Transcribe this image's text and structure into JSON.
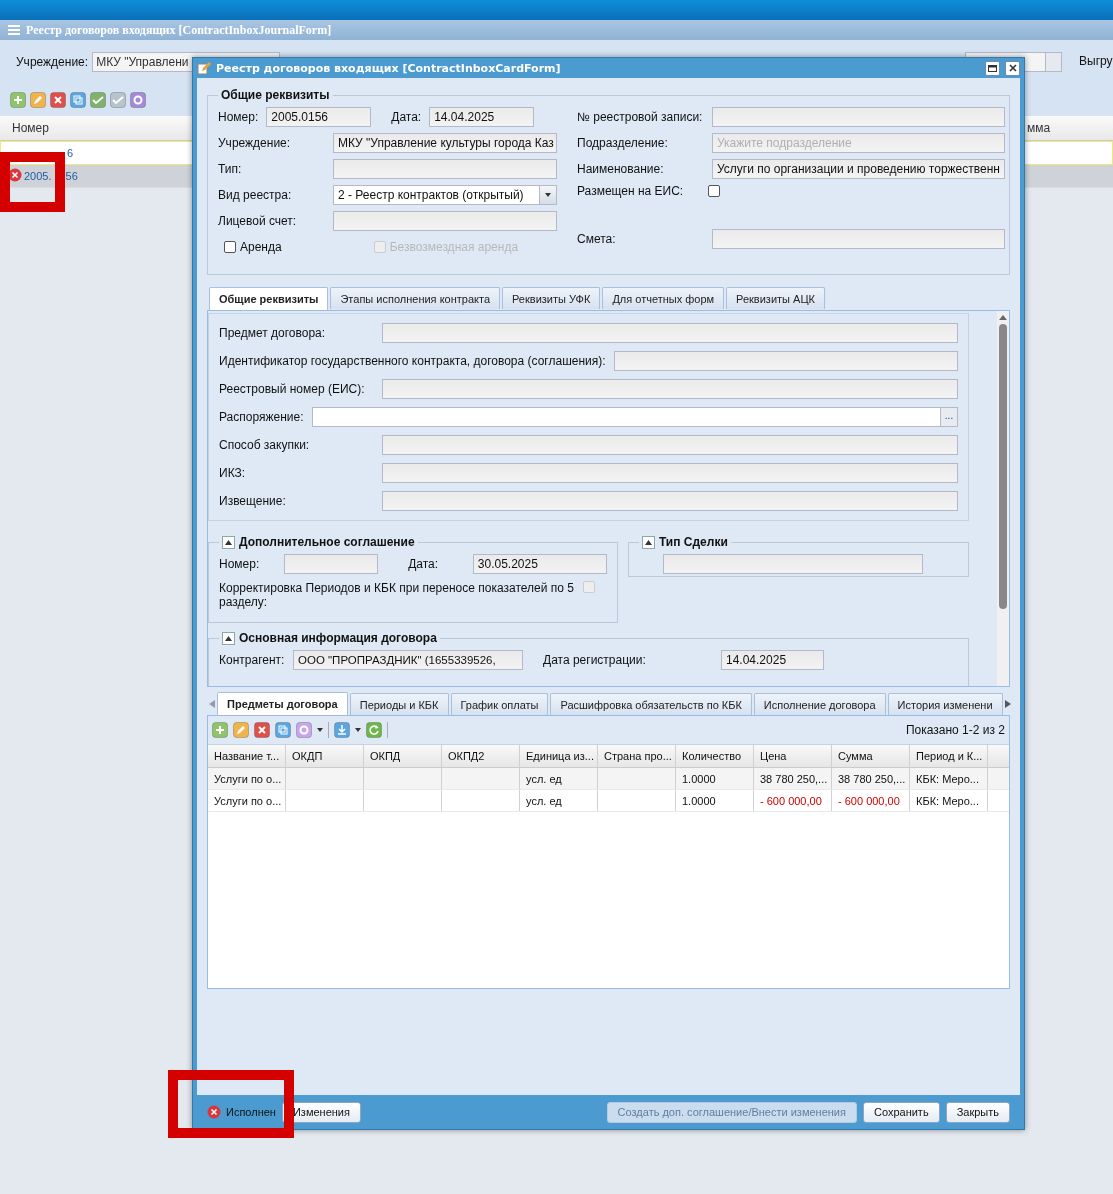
{
  "journal": {
    "title": "Реестр договоров входящих [ContractInboxJournalForm]",
    "filter_label": "Учреждение:",
    "filter_value": "МКУ \"Управлени",
    "export_label": "Выгру",
    "columns": [
      "Номер",
      "мма"
    ],
    "rows": [
      {
        "number": "6",
        "selected": true,
        "failed": false
      },
      {
        "number": "2005.",
        "number_tail": "56",
        "selected": false,
        "failed": true
      }
    ]
  },
  "card": {
    "title": "Реестр договоров входящих [ContractInboxCardForm]",
    "general": {
      "legend": "Общие реквизиты",
      "left": [
        [
          {
            "kind": "text",
            "label": "Номер:",
            "value": "2005.0156"
          },
          {
            "kind": "text",
            "label": "Дата:",
            "value": "14.04.2025"
          }
        ],
        [
          {
            "kind": "text",
            "label": "Учреждение:",
            "value": "МКУ \"Управление культуры города Каз"
          }
        ],
        [
          {
            "kind": "text",
            "label": "Тип:"
          }
        ],
        [
          {
            "kind": "select",
            "label": "Вид реестра:",
            "value": "2 - Реестр контрактов (открытый)"
          }
        ],
        [
          {
            "kind": "text",
            "label": "Лицевой счет:"
          }
        ],
        [
          {
            "kind": "checkbox",
            "label": "Аренда",
            "checked": false,
            "disabled": false
          },
          {
            "kind": "checkbox",
            "label": "Безвозмездная аренда",
            "checked": false,
            "disabled": true
          }
        ]
      ],
      "right": [
        [
          {
            "kind": "text",
            "label": "№ реестровой записи:"
          }
        ],
        [
          {
            "kind": "text",
            "label": "Подразделение:",
            "placeholder": "Укажите подразделение"
          }
        ],
        [
          {
            "kind": "text",
            "label": "Наименование:",
            "value": "Услуги по организации и проведению торжественн"
          }
        ],
        [
          {
            "kind": "checkbox_right",
            "label": "Размещен на ЕИС:",
            "checked": false,
            "disabled": false
          }
        ],
        [
          {
            "kind": "text",
            "label": "Смета:"
          }
        ]
      ]
    },
    "tabs": [
      {
        "label": "Общие реквизиты",
        "selected": true
      },
      {
        "label": "Этапы исполнения контракта",
        "selected": false
      },
      {
        "label": "Реквизиты УФК",
        "selected": false
      },
      {
        "label": "Для отчетных форм",
        "selected": false
      },
      {
        "label": "Реквизиты АЦК",
        "selected": false
      }
    ],
    "tab_fields": [
      {
        "kind": "text",
        "label": "Предмет договора:"
      },
      {
        "kind": "text",
        "label": "Идентификатор государственного контракта, договора (соглашения):"
      },
      {
        "kind": "text",
        "label": "Реестровый номер (ЕИС):"
      },
      {
        "kind": "picker",
        "label": "Распоряжение:",
        "button": "..."
      },
      {
        "kind": "text",
        "label": "Способ закупки:"
      },
      {
        "kind": "text",
        "label": "ИКЗ:"
      },
      {
        "kind": "text",
        "label": "Извещение:"
      }
    ],
    "agreement": {
      "legend": "Дополнительное соглашение",
      "expanded": true,
      "number_label": "Номер:",
      "date_label": "Дата:",
      "date_value": "30.05.2025",
      "correction_label": "Корректировка Периодов и КБК при переносе показателей по 5 разделу:",
      "correction_checked": false
    },
    "deal_type": {
      "legend": "Тип Сделки",
      "expanded": true
    },
    "main_info": {
      "legend": "Основная информация договора",
      "expanded": true,
      "counterparty_label": "Контрагент:",
      "counterparty_value": "ООО \"ПРОПРАЗДНИК\" (1655339526,",
      "reg_date_label": "Дата регистрации:",
      "reg_date_value": "14.04.2025"
    },
    "bottom_tabs": [
      {
        "label": "Предметы договора",
        "selected": true
      },
      {
        "label": "Периоды и КБК",
        "selected": false
      },
      {
        "label": "График оплаты",
        "selected": false
      },
      {
        "label": "Расшифровка обязательств по КБК",
        "selected": false
      },
      {
        "label": "Исполнение договора",
        "selected": false
      },
      {
        "label": "История изменени",
        "selected": false
      }
    ],
    "grid": {
      "shown": "Показано 1-2 из 2",
      "columns": [
        {
          "label": "Название т...",
          "kind": "text"
        },
        {
          "label": "ОКДП",
          "kind": "text"
        },
        {
          "label": "ОКПД",
          "kind": "text"
        },
        {
          "label": "ОКПД2",
          "kind": "text"
        },
        {
          "label": "Единица из...",
          "kind": "text"
        },
        {
          "label": "Страна про...",
          "kind": "text"
        },
        {
          "label": "Количество",
          "kind": "text"
        },
        {
          "label": "Цена",
          "kind": "amount"
        },
        {
          "label": "Сумма",
          "kind": "amount"
        },
        {
          "label": "Период и К...",
          "kind": "text"
        }
      ],
      "rows": [
        {
          "negative": false,
          "cells": [
            "Услуги по о...",
            "",
            "",
            "",
            "усл. ед",
            "",
            "1.0000",
            "38 780 250,...",
            "38 780 250,...",
            "КБК: Меро..."
          ]
        },
        {
          "negative": true,
          "cells": [
            "Услуги по о...",
            "",
            "",
            "",
            "усл. ед",
            "",
            "1.0000",
            "- 600 000,00",
            "- 600 000,00",
            "КБК: Меро..."
          ]
        }
      ]
    },
    "status": {
      "label": "Исполнен",
      "failed": true
    },
    "buttons": [
      {
        "label": "Изменения",
        "disabled": false
      },
      {
        "label": "Создать доп. соглашение/Внести изменения",
        "disabled": true
      },
      {
        "label": "Сохранить",
        "disabled": false
      },
      {
        "label": "Закрыть",
        "disabled": false
      }
    ]
  }
}
